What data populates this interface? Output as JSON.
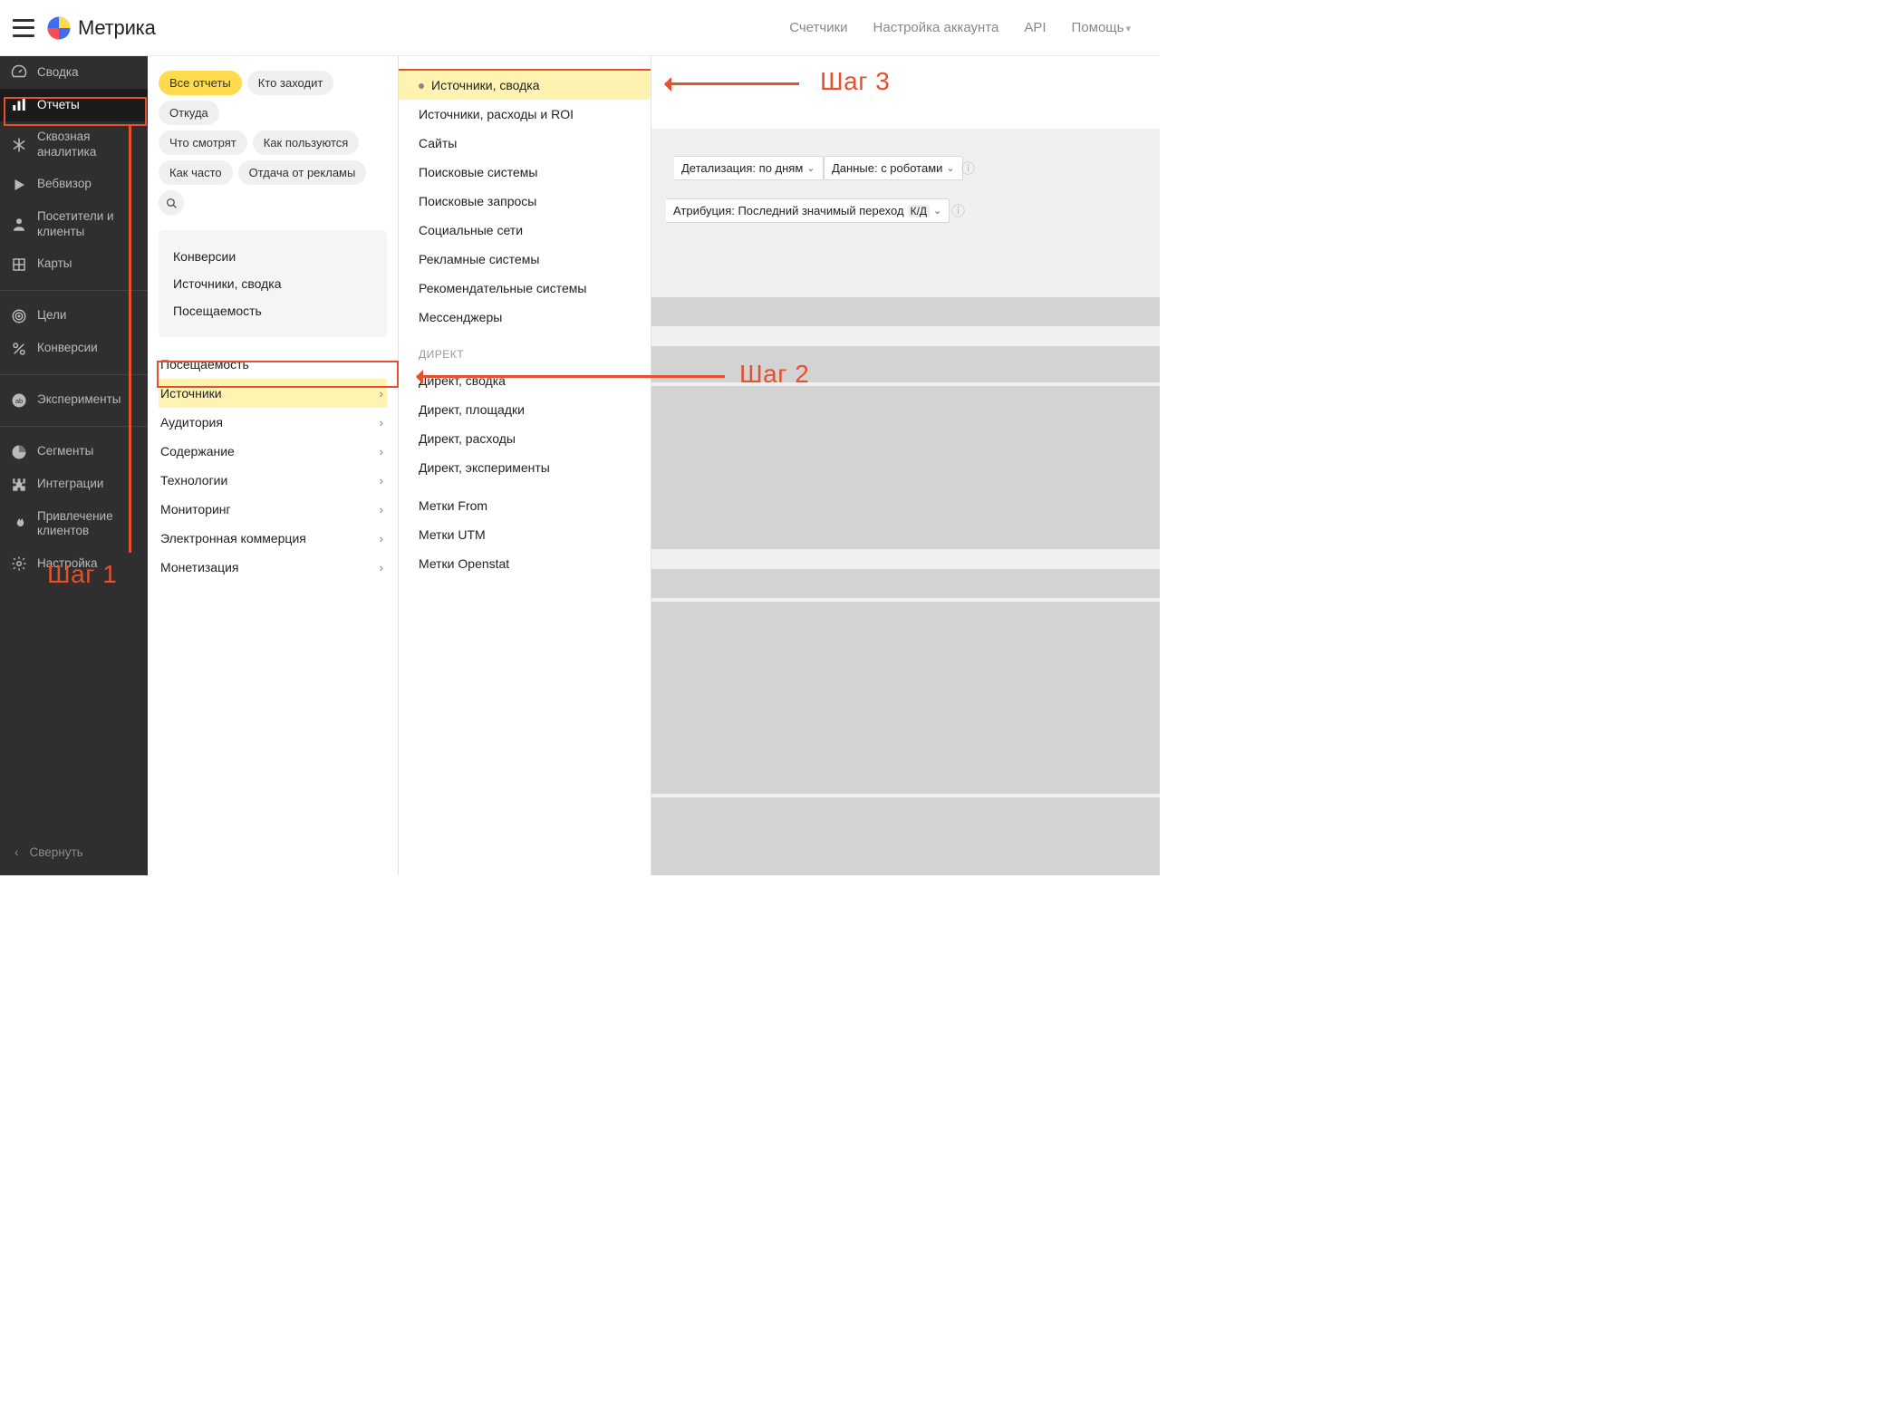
{
  "header": {
    "brand": "Метрика",
    "nav": [
      "Счетчики",
      "Настройка аккаунта",
      "API",
      "Помощь"
    ]
  },
  "sidebar": {
    "groups": [
      [
        {
          "label": "Сводка",
          "icon": "speedometer"
        },
        {
          "label": "Отчеты",
          "icon": "bar-chart",
          "active": true
        },
        {
          "label": "Сквозная аналитика",
          "icon": "asterisk"
        },
        {
          "label": "Вебвизор",
          "icon": "play"
        },
        {
          "label": "Посетители и клиенты",
          "icon": "person"
        },
        {
          "label": "Карты",
          "icon": "map"
        }
      ],
      [
        {
          "label": "Цели",
          "icon": "target"
        },
        {
          "label": "Конверсии",
          "icon": "percent"
        }
      ],
      [
        {
          "label": "Эксперименты",
          "icon": "ab"
        }
      ],
      [
        {
          "label": "Сегменты",
          "icon": "pie"
        },
        {
          "label": "Интеграции",
          "icon": "puzzle"
        },
        {
          "label": "Привлечение клиентов",
          "icon": "flame"
        },
        {
          "label": "Настройка",
          "icon": "gear"
        }
      ]
    ],
    "collapse_label": "Свернуть"
  },
  "panel1": {
    "chips": [
      "Все отчеты",
      "Кто заходит",
      "Откуда",
      "Что смотрят",
      "Как пользуются",
      "Как часто",
      "Отдача от рекламы"
    ],
    "quick": [
      "Конверсии",
      "Источники, сводка",
      "Посещаемость"
    ],
    "categories": [
      {
        "label": "Посещаемость",
        "has_children": false
      },
      {
        "label": "Источники",
        "has_children": true,
        "highlight": true
      },
      {
        "label": "Аудитория",
        "has_children": true
      },
      {
        "label": "Содержание",
        "has_children": true
      },
      {
        "label": "Технологии",
        "has_children": true
      },
      {
        "label": "Мониторинг",
        "has_children": true
      },
      {
        "label": "Электронная коммерция",
        "has_children": true
      },
      {
        "label": "Монетизация",
        "has_children": true
      }
    ]
  },
  "panel2": {
    "items1": [
      {
        "label": "Источники, сводка",
        "highlight": true
      },
      {
        "label": "Источники, расходы и ROI"
      },
      {
        "label": "Сайты"
      },
      {
        "label": "Поисковые системы"
      },
      {
        "label": "Поисковые запросы"
      },
      {
        "label": "Социальные сети"
      },
      {
        "label": "Рекламные системы"
      },
      {
        "label": "Рекомендательные системы"
      },
      {
        "label": "Мессенджеры"
      }
    ],
    "section_heading": "ДИРЕКТ",
    "items2": [
      {
        "label": "Директ, сводка"
      },
      {
        "label": "Директ, площадки"
      },
      {
        "label": "Директ, расходы"
      },
      {
        "label": "Директ, эксперименты"
      }
    ],
    "items3": [
      {
        "label": "Метки From"
      },
      {
        "label": "Метки UTM"
      },
      {
        "label": "Метки Openstat"
      }
    ]
  },
  "content": {
    "dropdown_detail": "Детализация: по дням",
    "dropdown_data": "Данные: с роботами",
    "dropdown_attrib": "Атрибуция: Последний значимый переход",
    "attrib_badge": "К/Д"
  },
  "annotations": {
    "step1": "Шаг 1",
    "step2": "Шаг 2",
    "step3": "Шаг 3"
  }
}
